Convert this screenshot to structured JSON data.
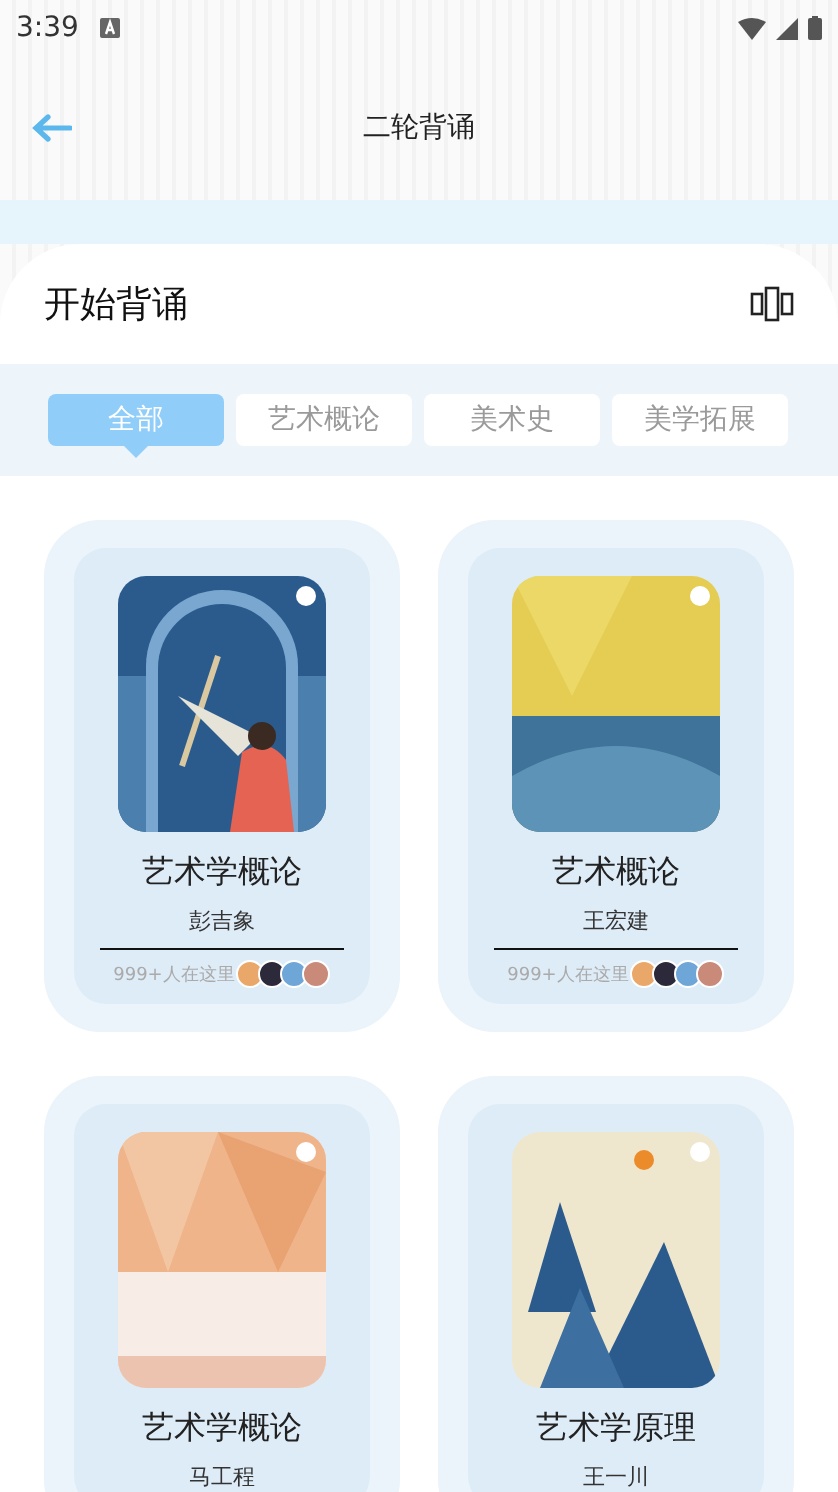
{
  "status_bar": {
    "time": "3:39"
  },
  "header": {
    "title": "二轮背诵"
  },
  "section": {
    "title": "开始背诵"
  },
  "tabs": [
    {
      "label": "全部",
      "selected": true
    },
    {
      "label": "艺术概论",
      "selected": false
    },
    {
      "label": "美术史",
      "selected": false
    },
    {
      "label": "美学拓展",
      "selected": false
    }
  ],
  "books": [
    {
      "title": "艺术学概论",
      "author": "彭吉象",
      "kind": "arch",
      "visitors": "999+人在这里"
    },
    {
      "title": "艺术概论",
      "author": "王宏建",
      "kind": "yellow",
      "visitors": "999+人在这里"
    },
    {
      "title": "艺术学概论",
      "author": "马工程",
      "kind": "peach"
    },
    {
      "title": "艺术学原理",
      "author": "王一川",
      "kind": "mountains"
    }
  ]
}
